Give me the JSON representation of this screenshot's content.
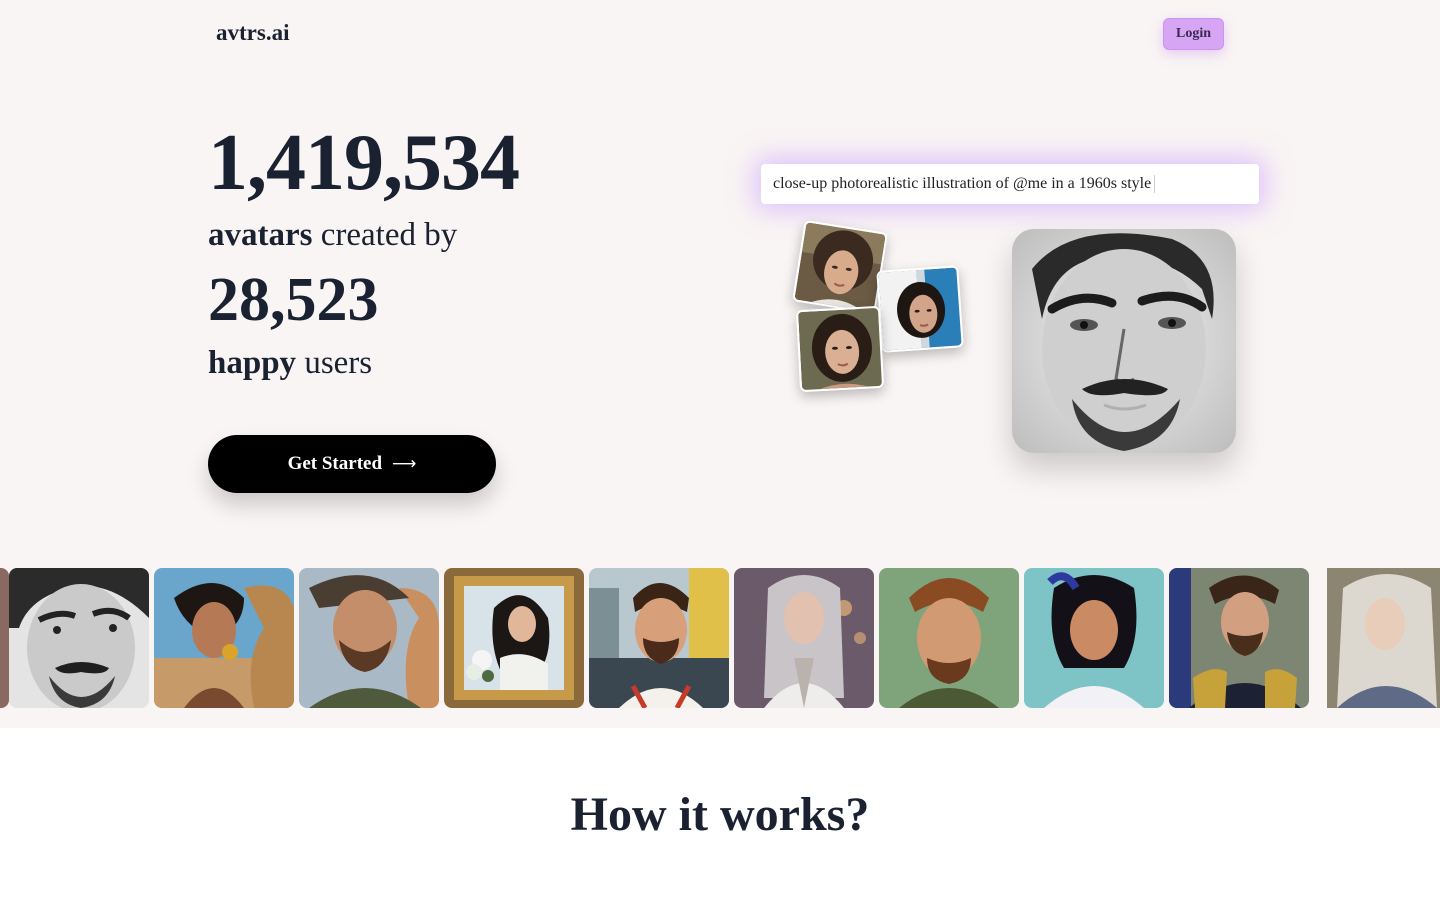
{
  "header": {
    "brand": "avtrs.ai",
    "login_label": "Login"
  },
  "hero": {
    "avatars_count": "1,419,534",
    "avatars_word": "avatars",
    "created_by": " created by",
    "users_count": "28,523",
    "happy_word": "happy",
    "users_word": " users",
    "cta_label": "Get Started",
    "cta_icon": "arrow-right-icon"
  },
  "prompt": {
    "text": "close-up photorealistic illustration of @me in a 1960s style"
  },
  "colors": {
    "page_bg": "#f9f5f4",
    "text": "#1a2131",
    "login_bg": "#d6a6f5",
    "prompt_glow": "#c896ff",
    "cta_bg": "#000000"
  },
  "gallery": {
    "items": [
      "man-sketch-avatar",
      "woman-camel-avatar",
      "man-hat-camel-avatar",
      "framed-woman-avatar",
      "man-retro-street-avatar",
      "woman-silver-hair-avatar",
      "man-cartoon-avatar",
      "girl-hoodie-avatar",
      "man-uniform-avatar",
      "woman-white-hair-avatar"
    ]
  },
  "how_section": {
    "title": "How it works?"
  }
}
